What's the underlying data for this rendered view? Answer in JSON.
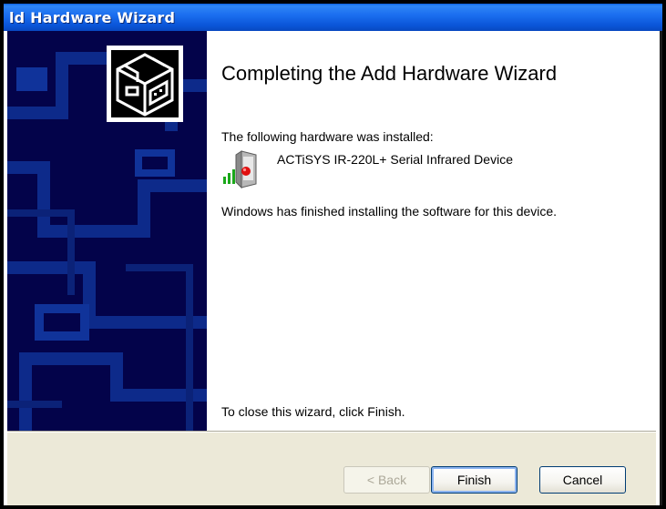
{
  "window": {
    "title": "ld Hardware Wizard"
  },
  "main": {
    "heading": "Completing the Add Hardware Wizard",
    "installed_label": "The following hardware was installed:",
    "device_name": "ACTiSYS IR-220L+ Serial Infrared Device",
    "finished_text": "Windows has finished installing the software for this device.",
    "close_hint": "To close this wizard, click Finish."
  },
  "buttons": {
    "back_label": "< Back",
    "finish_label": "Finish",
    "cancel_label": "Cancel",
    "back_enabled": false
  },
  "icons": {
    "wizard": "hardware-box-icon",
    "device": "infrared-device-icon"
  },
  "colors": {
    "titlebar": "#0a55d8",
    "banner": "#03034a",
    "footer": "#ece9d8",
    "accent_border": "#003c74"
  }
}
